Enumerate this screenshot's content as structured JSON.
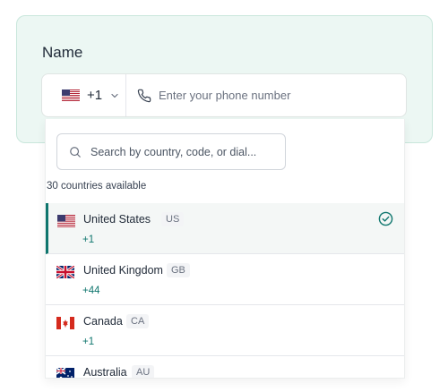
{
  "form": {
    "label": "Name",
    "phone_placeholder": "Enter your phone number",
    "selected_flag": "flag-us",
    "selected_dial": "+1"
  },
  "dropdown": {
    "search_placeholder": "Search by country, code, or dial...",
    "count_text": "30 countries available",
    "countries": [
      {
        "flag": "flag-us",
        "name": "United States",
        "code": "US",
        "dial": "+1",
        "selected": true
      },
      {
        "flag": "flag-gb",
        "name": "United Kingdom",
        "code": "GB",
        "dial": "+44",
        "selected": false
      },
      {
        "flag": "flag-ca",
        "name": "Canada",
        "code": "CA",
        "dial": "+1",
        "selected": false
      },
      {
        "flag": "flag-au",
        "name": "Australia",
        "code": "AU",
        "dial": "",
        "selected": false
      }
    ]
  },
  "colors": {
    "card_bg": "#ecf7f3",
    "accent": "#0f766e",
    "selected_row_bg": "#f4f7f6"
  },
  "icons": {
    "chevron": "chevron-down-icon",
    "phone": "phone-icon",
    "search": "search-icon",
    "check": "check-circle-icon"
  }
}
